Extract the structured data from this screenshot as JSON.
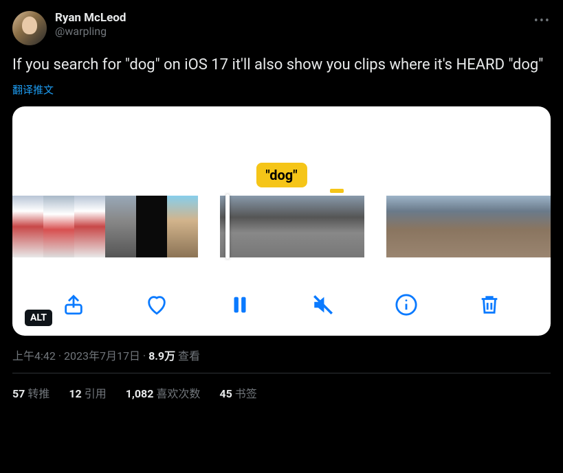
{
  "author": {
    "display_name": "Ryan McLeod",
    "handle": "@warpling"
  },
  "tweet_text": "If you search for \"dog\" on iOS 17 it'll also show you clips where it's HEARD \"dog\"",
  "translate_label": "翻译推文",
  "media": {
    "caption_bubble": "\"dog\"",
    "alt_badge": "ALT",
    "toolbar_icons": [
      "share",
      "heart",
      "pause",
      "mute",
      "info",
      "trash"
    ]
  },
  "meta": {
    "time": "上午4:42",
    "date": "2023年7月17日",
    "separator": " · ",
    "views_count": "8.9万",
    "views_label": " 查看"
  },
  "stats": {
    "retweets": {
      "count": "57",
      "label": "转推"
    },
    "quotes": {
      "count": "12",
      "label": "引用"
    },
    "likes": {
      "count": "1,082",
      "label": "喜欢次数"
    },
    "bookmarks": {
      "count": "45",
      "label": "书签"
    }
  }
}
